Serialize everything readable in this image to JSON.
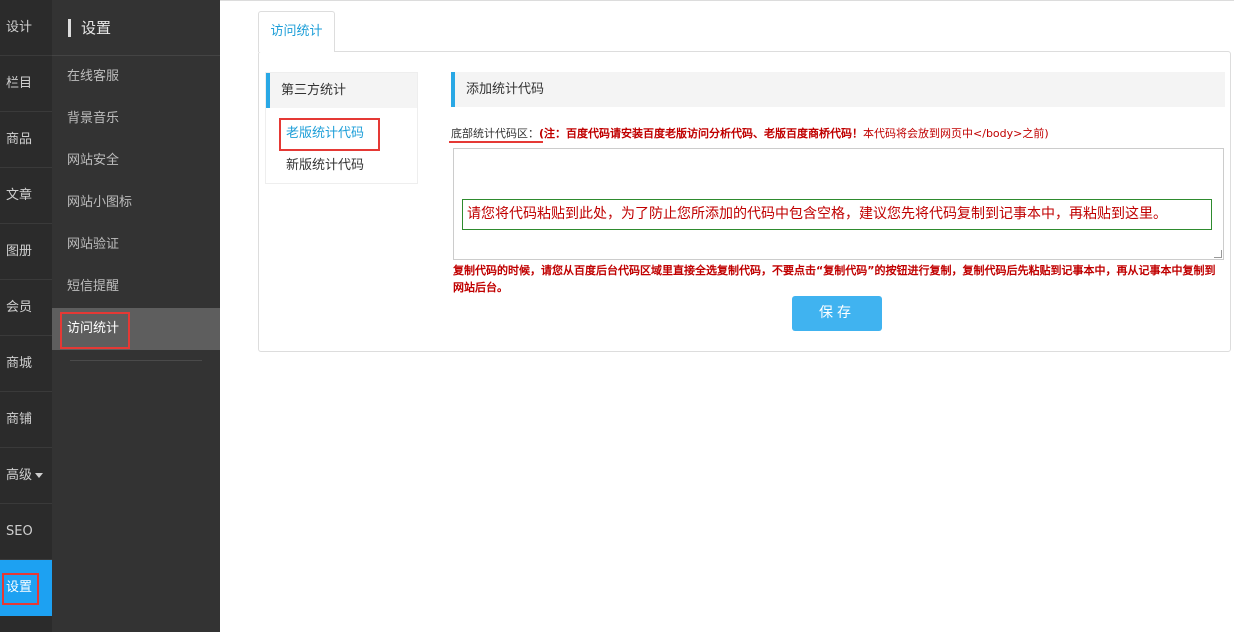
{
  "rail": {
    "items": [
      {
        "label": "设计"
      },
      {
        "label": "栏目"
      },
      {
        "label": "商品"
      },
      {
        "label": "文章"
      },
      {
        "label": "图册"
      },
      {
        "label": "会员"
      },
      {
        "label": "商城"
      },
      {
        "label": "商铺"
      },
      {
        "label": "高级"
      },
      {
        "label": "SEO"
      },
      {
        "label": "设置"
      }
    ]
  },
  "submenu": {
    "title": "设置",
    "items": [
      {
        "label": "在线客服"
      },
      {
        "label": "背景音乐"
      },
      {
        "label": "网站安全"
      },
      {
        "label": "网站小图标"
      },
      {
        "label": "网站验证"
      },
      {
        "label": "短信提醒"
      },
      {
        "label": "访问统计"
      }
    ]
  },
  "main": {
    "tab_label": "访问统计",
    "side": {
      "title": "第三方统计",
      "items": [
        {
          "label": "老版统计代码"
        },
        {
          "label": "新版统计代码"
        }
      ]
    },
    "content": {
      "title": "添加统计代码",
      "field_label": "底部统计代码区：",
      "note_bold": "(注：百度代码请安装百度老版访问分析代码、老版百度商桥代码！",
      "note_rest": "本代码将会放到网页中</body>之前)",
      "placeholder": "请您将代码粘贴到此处，为了防止您所添加的代码中包含空格，建议您先将代码复制到记事本中，再粘贴到这里。",
      "warning": "复制代码的时候，请您从百度后台代码区域里直接全选复制代码，不要点击“复制代码”的按钮进行复制，复制代码后先粘贴到记事本中，再从记事本中复制到网站后台。",
      "save_label": "保存"
    }
  },
  "colors": {
    "accent": "#1da1f2",
    "highlight": "#e53935",
    "warning_text": "#c00000"
  }
}
